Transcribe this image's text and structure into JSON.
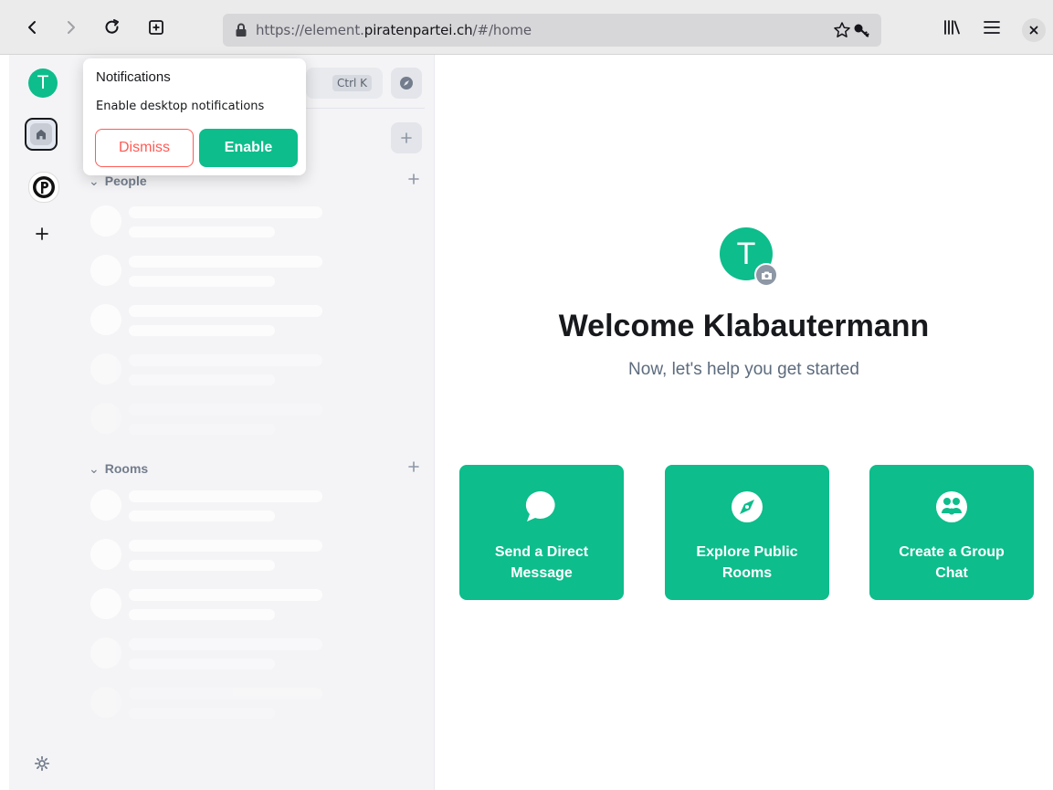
{
  "browser": {
    "url_prefix": "https://element.",
    "url_domain": "piratenpartei.ch",
    "url_suffix": "/#/home"
  },
  "spaces": {
    "user_initial": "T"
  },
  "roomlist": {
    "shortcut": "Ctrl K",
    "sections": [
      {
        "label": "People"
      },
      {
        "label": "Rooms"
      }
    ]
  },
  "toast": {
    "title": "Notifications",
    "body": "Enable desktop notifications",
    "dismiss_label": "Dismiss",
    "enable_label": "Enable"
  },
  "home": {
    "avatar_initial": "T",
    "welcome": "Welcome Klabautermann",
    "subtitle": "Now, let's help you get started",
    "actions": [
      {
        "label_line1": "Send a Direct",
        "label_line2": "Message",
        "icon": "message-icon"
      },
      {
        "label_line1": "Explore Public",
        "label_line2": "Rooms",
        "icon": "compass-icon"
      },
      {
        "label_line1": "Create a Group",
        "label_line2": "Chat",
        "icon": "group-icon"
      }
    ]
  },
  "colors": {
    "accent": "#0dbd8b",
    "danger": "#ff5b55"
  }
}
